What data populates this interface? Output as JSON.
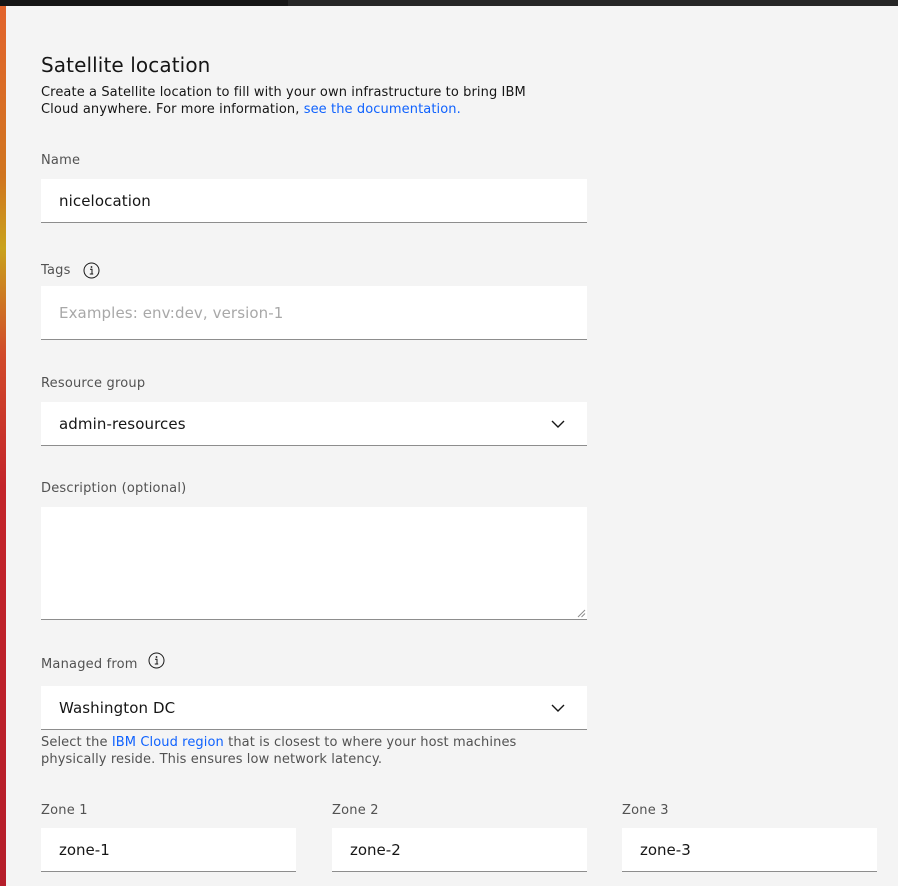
{
  "form": {
    "title": "Satellite location",
    "intro_text": "Create a Satellite location to fill with your own infrastructure to bring IBM Cloud anywhere. For more information, ",
    "intro_link": "see the documentation.",
    "name": {
      "label": "Name",
      "value": "nicelocation"
    },
    "tags": {
      "label": "Tags",
      "placeholder": "Examples: env:dev, version-1",
      "info_icon": "info-icon"
    },
    "resource_group": {
      "label": "Resource group",
      "value": "admin-resources",
      "icon": "chevron-down-icon"
    },
    "description": {
      "label": "Description (optional)",
      "value": ""
    },
    "managed_from": {
      "label": "Managed from",
      "value": "Washington DC",
      "info_icon": "info-icon",
      "icon": "chevron-down-icon",
      "helper_prefix": "Select the ",
      "helper_link": "IBM Cloud region",
      "helper_suffix": " that is closest to where your host machines physically reside. This ensures low network latency."
    },
    "zones": [
      {
        "label": "Zone 1",
        "value": "zone-1"
      },
      {
        "label": "Zone 2",
        "value": "zone-2"
      },
      {
        "label": "Zone 3",
        "value": "zone-3"
      }
    ]
  },
  "colors": {
    "link": "#0f62fe",
    "field_background": "#ffffff",
    "page_background": "#f4f4f4",
    "label_text": "#525252"
  }
}
